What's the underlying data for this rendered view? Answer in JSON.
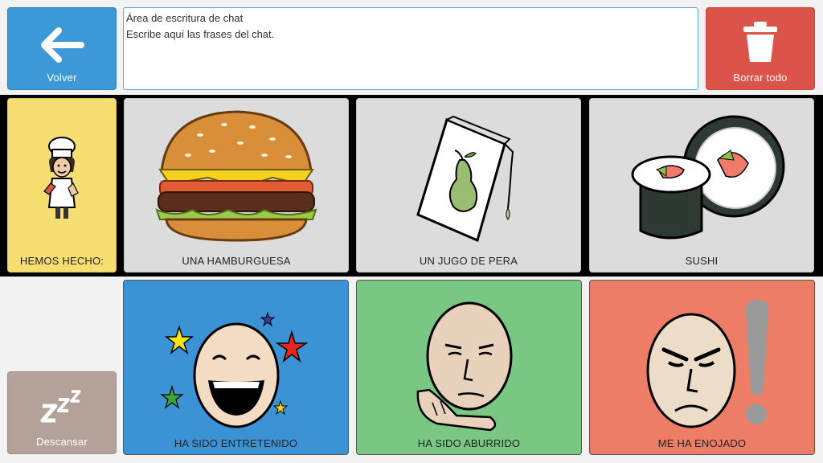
{
  "toolbar": {
    "back_label": "Volver",
    "clear_label": "Borrar todo",
    "rest_label": "Descansar"
  },
  "chat": {
    "title": "Área de escritura de chat",
    "placeholder": "Escribe aquí las frases del chat."
  },
  "row1": {
    "subject_label": "HEMOS HECHO:",
    "items": [
      {
        "label": "UNA HAMBURGUESA",
        "icon": "hamburger-icon"
      },
      {
        "label": "UN JUGO DE PERA",
        "icon": "pear-juice-icon"
      },
      {
        "label": "SUSHI",
        "icon": "sushi-icon"
      }
    ]
  },
  "row2": {
    "items": [
      {
        "label": "HA SIDO ENTRETENIDO",
        "icon": "laughing-face-icon",
        "color": "#3b93d6"
      },
      {
        "label": "HA SIDO ABURRIDO",
        "icon": "bored-face-icon",
        "color": "#7ac784"
      },
      {
        "label": "ME HA ENOJADO",
        "icon": "angry-face-icon",
        "color": "#ed7d67"
      }
    ]
  }
}
